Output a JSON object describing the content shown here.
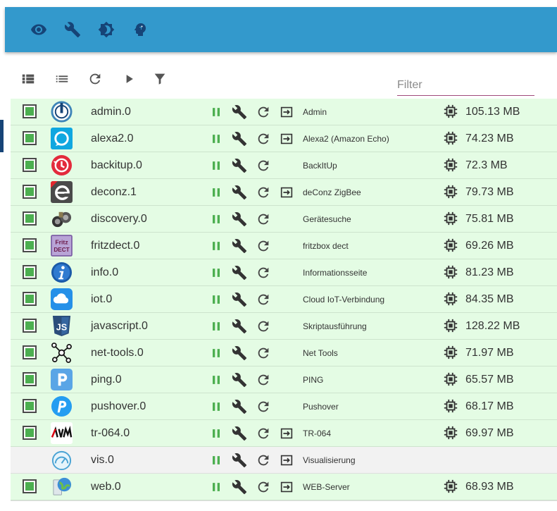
{
  "appbar": {
    "icons": [
      "eye-icon",
      "wrench-icon",
      "brightness-icon",
      "expert-head-icon"
    ]
  },
  "toolbar": {
    "icons": [
      "tile-view-icon",
      "list-view-icon",
      "refresh-icon",
      "play-icon",
      "filter-icon"
    ],
    "filter_placeholder": "Filter",
    "filter_value": ""
  },
  "colors": {
    "appbar": "#3399cc",
    "icon_dark": "#164477",
    "row_enabled": "#e4fce4",
    "row_disabled": "#f2f2f2",
    "pause_green": "#4caf50"
  },
  "instances": [
    {
      "name": "admin.0",
      "title": "Admin",
      "memory": "105.13 MB",
      "enabled": true,
      "has_link": true,
      "logo": "admin"
    },
    {
      "name": "alexa2.0",
      "title": "Alexa2 (Amazon Echo)",
      "memory": "74.23 MB",
      "enabled": true,
      "has_link": true,
      "logo": "alexa"
    },
    {
      "name": "backitup.0",
      "title": "BackItUp",
      "memory": "72.3 MB",
      "enabled": true,
      "has_link": false,
      "logo": "backitup"
    },
    {
      "name": "deconz.1",
      "title": "deConz ZigBee",
      "memory": "79.73 MB",
      "enabled": true,
      "has_link": true,
      "logo": "deconz"
    },
    {
      "name": "discovery.0",
      "title": "Gerätesuche",
      "memory": "75.81 MB",
      "enabled": true,
      "has_link": false,
      "logo": "discovery"
    },
    {
      "name": "fritzdect.0",
      "title": "fritzbox dect",
      "memory": "69.26 MB",
      "enabled": true,
      "has_link": false,
      "logo": "fritzdect",
      "logo_text": [
        "Fritz",
        "DECT"
      ]
    },
    {
      "name": "info.0",
      "title": "Informationsseite",
      "memory": "81.23 MB",
      "enabled": true,
      "has_link": false,
      "logo": "info"
    },
    {
      "name": "iot.0",
      "title": "Cloud IoT-Verbindung",
      "memory": "84.35 MB",
      "enabled": true,
      "has_link": false,
      "logo": "iot"
    },
    {
      "name": "javascript.0",
      "title": "Skriptausführung",
      "memory": "128.22 MB",
      "enabled": true,
      "has_link": false,
      "logo": "javascript"
    },
    {
      "name": "net-tools.0",
      "title": "Net Tools",
      "memory": "71.97 MB",
      "enabled": true,
      "has_link": false,
      "logo": "nettools"
    },
    {
      "name": "ping.0",
      "title": "PING",
      "memory": "65.57 MB",
      "enabled": true,
      "has_link": false,
      "logo": "ping"
    },
    {
      "name": "pushover.0",
      "title": "Pushover",
      "memory": "68.17 MB",
      "enabled": true,
      "has_link": false,
      "logo": "pushover"
    },
    {
      "name": "tr-064.0",
      "title": "TR-064",
      "memory": "69.97 MB",
      "enabled": true,
      "has_link": true,
      "logo": "avm"
    },
    {
      "name": "vis.0",
      "title": "Visualisierung",
      "memory": "",
      "enabled": false,
      "has_link": true,
      "logo": "vis"
    },
    {
      "name": "web.0",
      "title": "WEB-Server",
      "memory": "68.93 MB",
      "enabled": true,
      "has_link": true,
      "logo": "web"
    }
  ]
}
